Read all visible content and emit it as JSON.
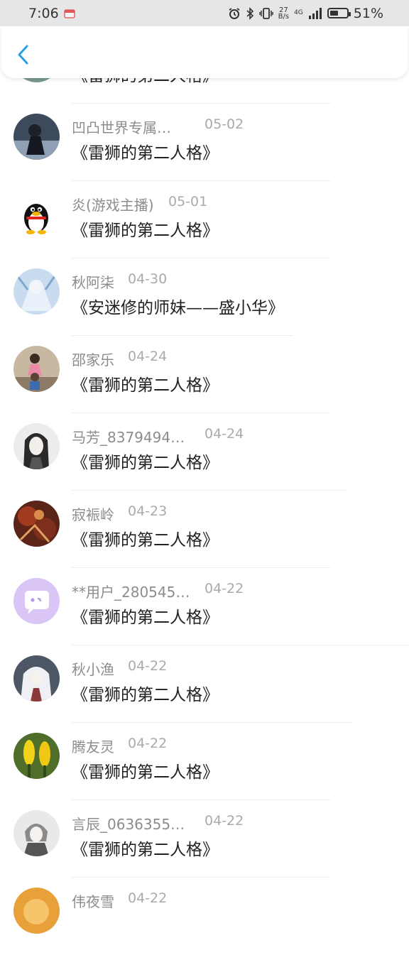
{
  "status_bar": {
    "time": "7:06",
    "net_speed_value": "27",
    "net_speed_unit": "B/s",
    "network_type": "4G",
    "battery_percent": "51%",
    "battery_level": 0.51
  },
  "items": [
    {
      "name": "",
      "date": "",
      "title": "《雷狮的第二人格》",
      "avatar": "avatar-landscape"
    },
    {
      "name": "凹凸世界专属…",
      "date": "05-02",
      "title": "《雷狮的第二人格》",
      "avatar": "avatar-dark-figure"
    },
    {
      "name": "炎(游戏主播)",
      "date": "05-01",
      "title": "《雷狮的第二人格》",
      "avatar": "avatar-penguin"
    },
    {
      "name": "秋阿柒",
      "date": "04-30",
      "title": "《安迷修的师妹——盛小华》",
      "avatar": "avatar-anime-blue"
    },
    {
      "name": "邵家乐",
      "date": "04-24",
      "title": "《雷狮的第二人格》",
      "avatar": "avatar-kids-photo"
    },
    {
      "name": "马芳_8379494…",
      "date": "04-24",
      "title": "《雷狮的第二人格》",
      "avatar": "avatar-girl-sketch"
    },
    {
      "name": "寂裖岭",
      "date": "04-23",
      "title": "《雷狮的第二人格》",
      "avatar": "avatar-red-art"
    },
    {
      "name": "**用户_280545…",
      "date": "04-22",
      "title": "《雷狮的第二人格》",
      "avatar": "avatar-default-chat"
    },
    {
      "name": "秋小渔",
      "date": "04-22",
      "title": "《雷狮的第二人格》",
      "avatar": "avatar-anime-white"
    },
    {
      "name": "腾友灵",
      "date": "04-22",
      "title": "《雷狮的第二人格》",
      "avatar": "avatar-yellow-flower"
    },
    {
      "name": "言辰_0636355…",
      "date": "04-22",
      "title": "《雷狮的第二人格》",
      "avatar": "avatar-anime-grey"
    },
    {
      "name": "伟夜雪",
      "date": "04-22",
      "title": "",
      "avatar": "avatar-orange"
    }
  ]
}
